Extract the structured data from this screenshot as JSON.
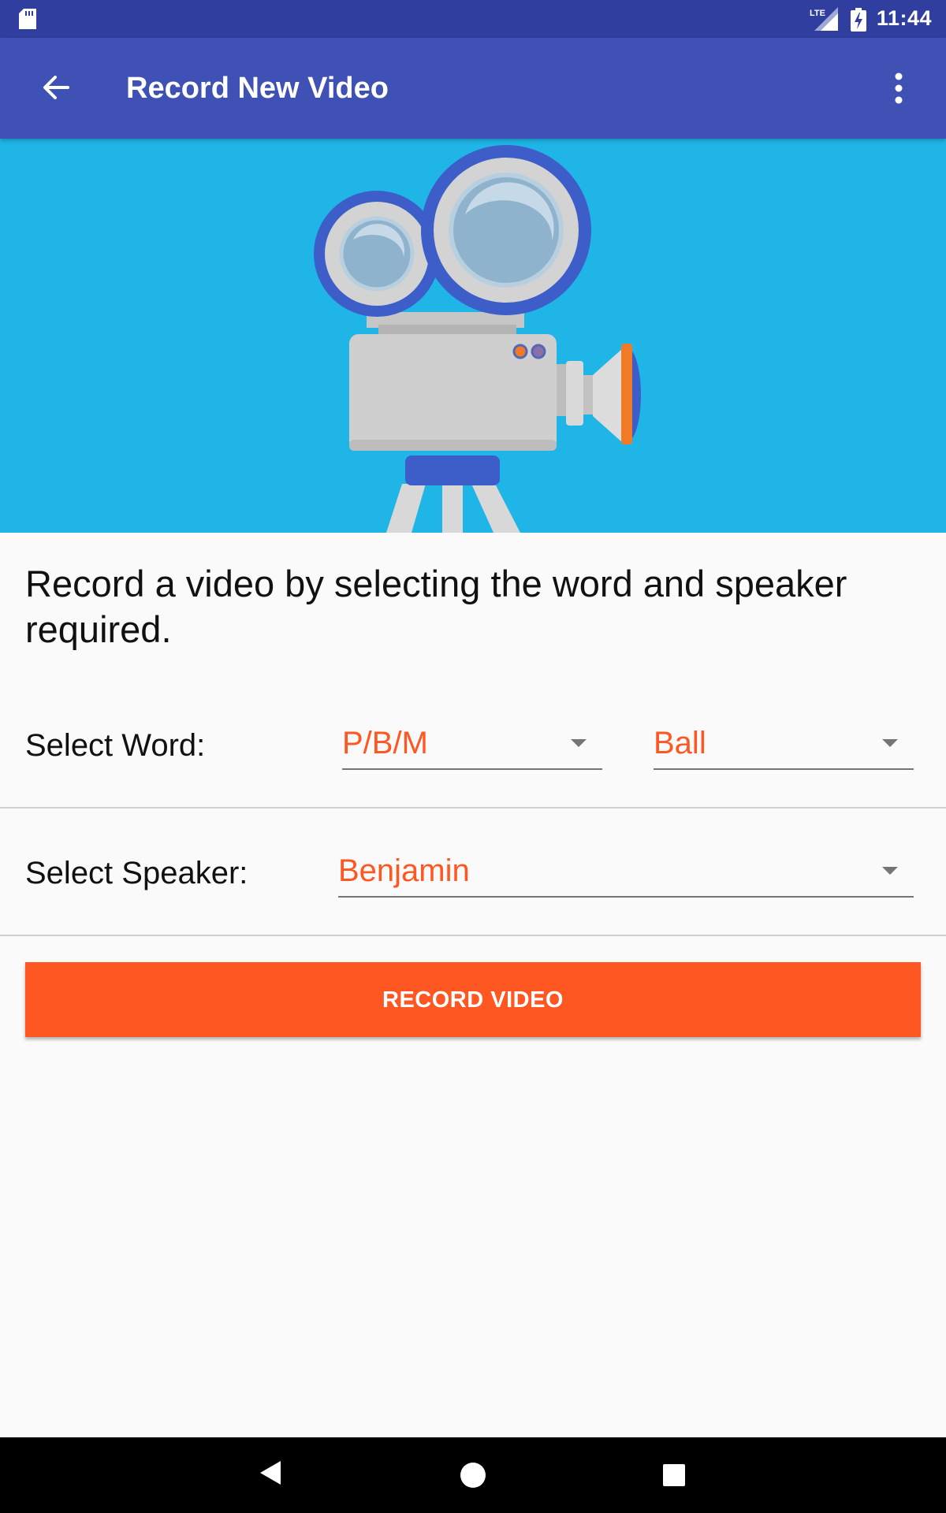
{
  "status_bar": {
    "time": "11:44",
    "network": "LTE",
    "icons": [
      "sd-card-icon",
      "lte-signal-icon",
      "battery-charging-icon"
    ]
  },
  "app_bar": {
    "title": "Record New Video",
    "icons": [
      "back-arrow-icon",
      "more-vert-icon"
    ]
  },
  "hero": {
    "illustration": "video-camera-on-tripod",
    "background_color": "#1fb5e6"
  },
  "instructions": "Record a video by selecting the word and speaker required.",
  "word_row": {
    "label": "Select Word:",
    "group_value": "P/B/M",
    "word_value": "Ball"
  },
  "speaker_row": {
    "label": "Select Speaker:",
    "value": "Benjamin"
  },
  "record_button": {
    "label": "RECORD VIDEO",
    "color": "#ff5722"
  },
  "nav_bar": {
    "icons": [
      "nav-back-icon",
      "nav-home-icon",
      "nav-recents-icon"
    ]
  },
  "colors": {
    "primary": "#3f51b5",
    "primary_dark": "#303f9f",
    "accent": "#ff5722"
  }
}
